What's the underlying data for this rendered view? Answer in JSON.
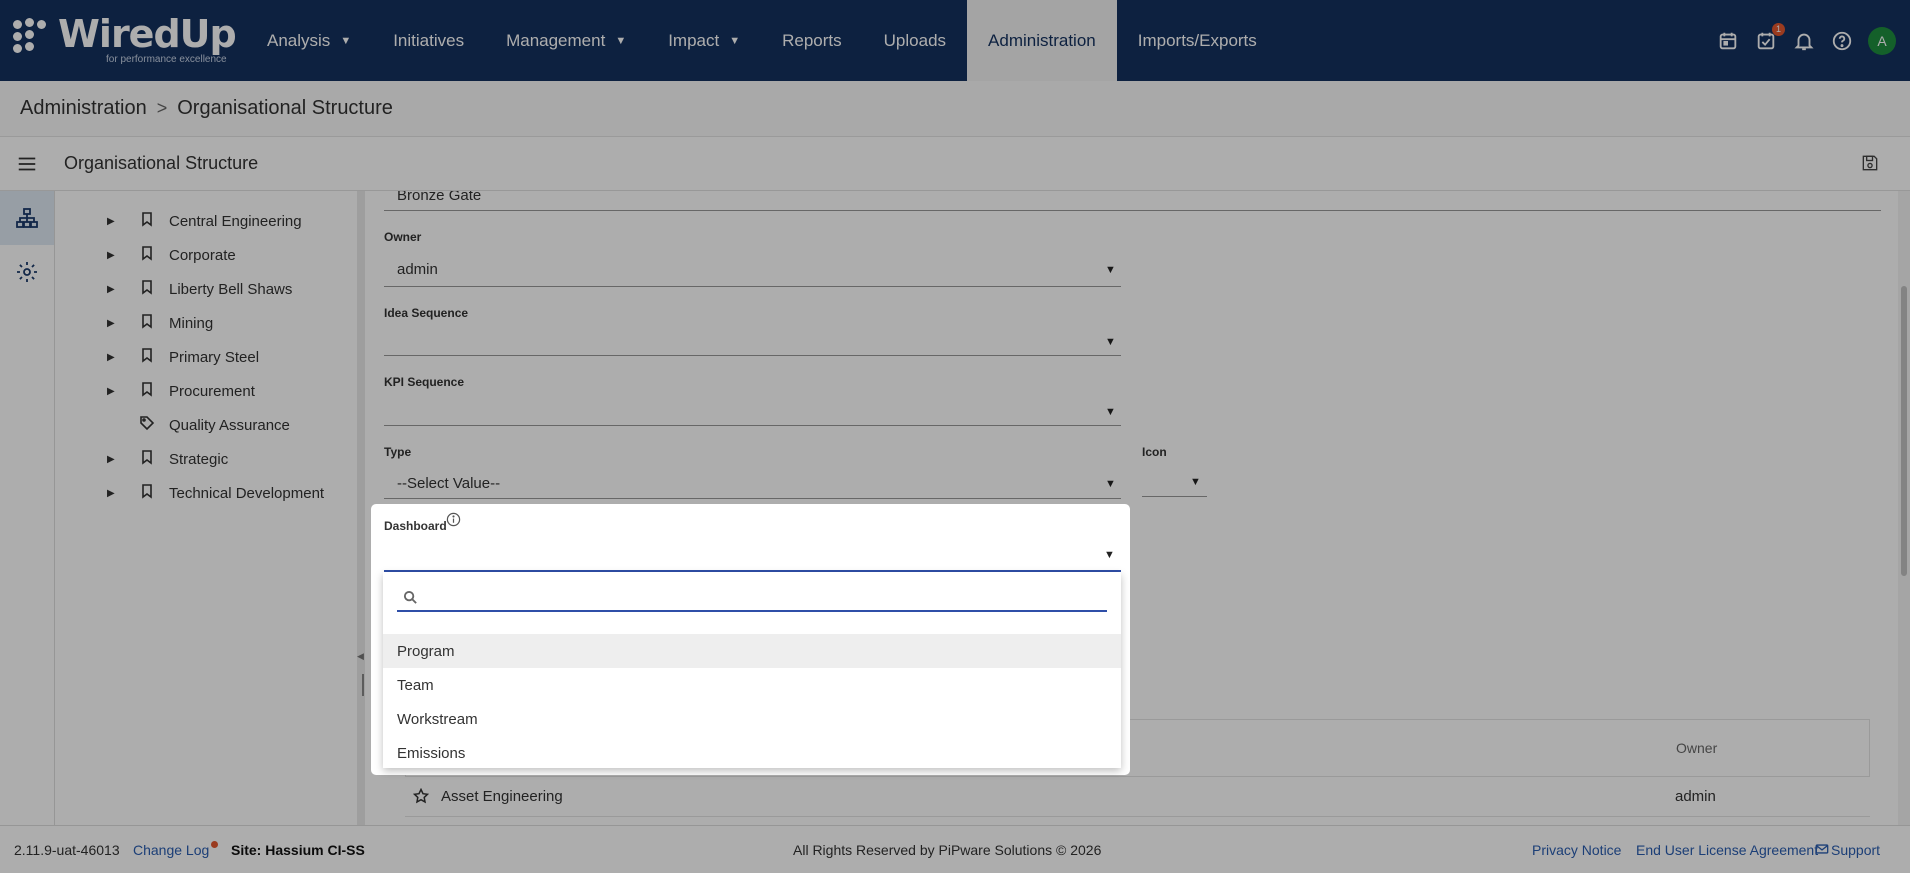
{
  "brand": {
    "name": "WiredUp",
    "tagline": "for performance excellence"
  },
  "nav": {
    "items": [
      {
        "label": "Analysis",
        "has_menu": true
      },
      {
        "label": "Initiatives",
        "has_menu": false
      },
      {
        "label": "Management",
        "has_menu": true
      },
      {
        "label": "Impact",
        "has_menu": true
      },
      {
        "label": "Reports",
        "has_menu": false
      },
      {
        "label": "Uploads",
        "has_menu": false
      },
      {
        "label": "Administration",
        "has_menu": false,
        "active": true
      },
      {
        "label": "Imports/Exports",
        "has_menu": false
      }
    ],
    "caret": "▼",
    "icons": [
      "calendar-icon",
      "task-check-icon",
      "bell-icon",
      "help-icon"
    ],
    "task_badge": "1",
    "avatar_letter": "A"
  },
  "breadcrumb": {
    "root": "Administration",
    "separator": ">",
    "current": "Organisational Structure"
  },
  "toolbar": {
    "title": "Organisational Structure"
  },
  "tree": {
    "items": [
      {
        "label": "Central Engineering",
        "expandable": true,
        "icon": "bookmark-icon"
      },
      {
        "label": "Corporate",
        "expandable": true,
        "icon": "bookmark-icon"
      },
      {
        "label": "Liberty Bell Shaws",
        "expandable": true,
        "icon": "bookmark-icon"
      },
      {
        "label": "Mining",
        "expandable": true,
        "icon": "bookmark-icon"
      },
      {
        "label": "Primary Steel",
        "expandable": true,
        "icon": "bookmark-icon"
      },
      {
        "label": "Procurement",
        "expandable": true,
        "icon": "bookmark-icon"
      },
      {
        "label": "Quality Assurance",
        "expandable": false,
        "icon": "tag-icon"
      },
      {
        "label": "Strategic",
        "expandable": true,
        "icon": "bookmark-icon"
      },
      {
        "label": "Technical Development",
        "expandable": true,
        "icon": "bookmark-icon"
      }
    ]
  },
  "form": {
    "name_value": "Bronze Gate",
    "owner": {
      "label": "Owner",
      "value": "admin"
    },
    "idea_sequence": {
      "label": "Idea Sequence",
      "value": ""
    },
    "kpi_sequence": {
      "label": "KPI Sequence",
      "value": ""
    },
    "type": {
      "label": "Type",
      "value": "--Select Value--"
    },
    "icon": {
      "label": "Icon",
      "value": ""
    },
    "dashboard": {
      "label": "Dashboard",
      "value": ""
    }
  },
  "dropdown": {
    "search_placeholder": "",
    "options": [
      "Program",
      "Team",
      "Workstream",
      "Emissions"
    ],
    "highlighted": "Program"
  },
  "table": {
    "owner_header": "Owner",
    "rows": [
      {
        "name": "Asset Engineering",
        "owner": "admin"
      }
    ]
  },
  "footer": {
    "version": "2.11.9-uat-46013",
    "change_log": "Change Log",
    "site": "Site: Hassium CI-SS",
    "rights": "All Rights Reserved by PiPware Solutions © 2026",
    "privacy": "Privacy Notice",
    "eula": "End User License Agreement",
    "support": "Support"
  },
  "colors": {
    "nav_bg": "#14315f",
    "accent": "#2f4fa8",
    "badge": "#e4572e",
    "avatar": "#1e8e3e",
    "link": "#2a5db0"
  }
}
